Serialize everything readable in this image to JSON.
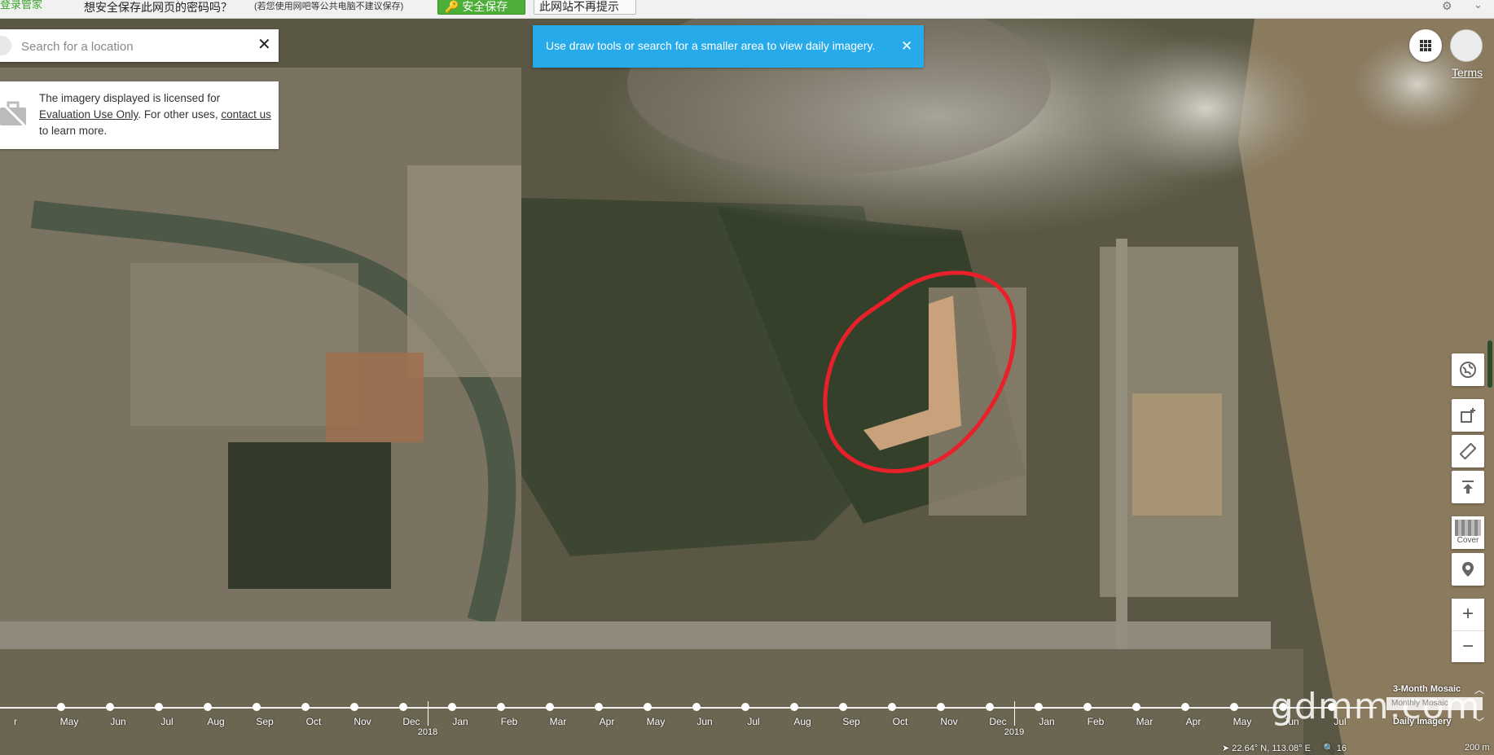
{
  "browser_bar": {
    "brand": "登录管家",
    "question": "想安全保存此网页的密码吗？",
    "note": "(若您使用网吧等公共电脑不建议保存)",
    "save_button": "安全保存",
    "no_remind_button": "此网站不再提示"
  },
  "search": {
    "placeholder": "Search for a location"
  },
  "license": {
    "text_1": "The imagery displayed is licensed for ",
    "link_1": "Evaluation Use Only",
    "text_2": ". For other uses, ",
    "link_2": "contact us",
    "text_3": " to learn more."
  },
  "toast": {
    "message": "Use draw tools or search for a smaller area to view daily imagery."
  },
  "top_right": {
    "terms": "Terms"
  },
  "tools": {
    "cover_label": "Cover",
    "zoom_in": "+",
    "zoom_out": "−"
  },
  "timeline": {
    "months": [
      "r",
      "May",
      "Jun",
      "Jul",
      "Aug",
      "Sep",
      "Oct",
      "Nov",
      "Dec",
      "Jan",
      "Feb",
      "Mar",
      "Apr",
      "May",
      "Jun",
      "Jul",
      "Aug",
      "Sep",
      "Oct",
      "Nov",
      "Dec",
      "Jan",
      "Feb",
      "Mar",
      "Apr",
      "May",
      "Jun",
      "Jul"
    ],
    "years": [
      {
        "label": "2018",
        "after_index": 8
      },
      {
        "label": "2019",
        "after_index": 20
      }
    ]
  },
  "mosaic": {
    "three_month": "3-Month Mosaic",
    "monthly": "Monthly Mosaic",
    "daily": "Daily Imagery"
  },
  "watermark": "gdmm.com",
  "status": {
    "coords": "22.64° N, 113.08° E",
    "zoom": "16",
    "scale": "200 m"
  },
  "colors": {
    "toast": "#26aaea",
    "annotation": "#e8202a",
    "save_button": "#4cae37"
  }
}
